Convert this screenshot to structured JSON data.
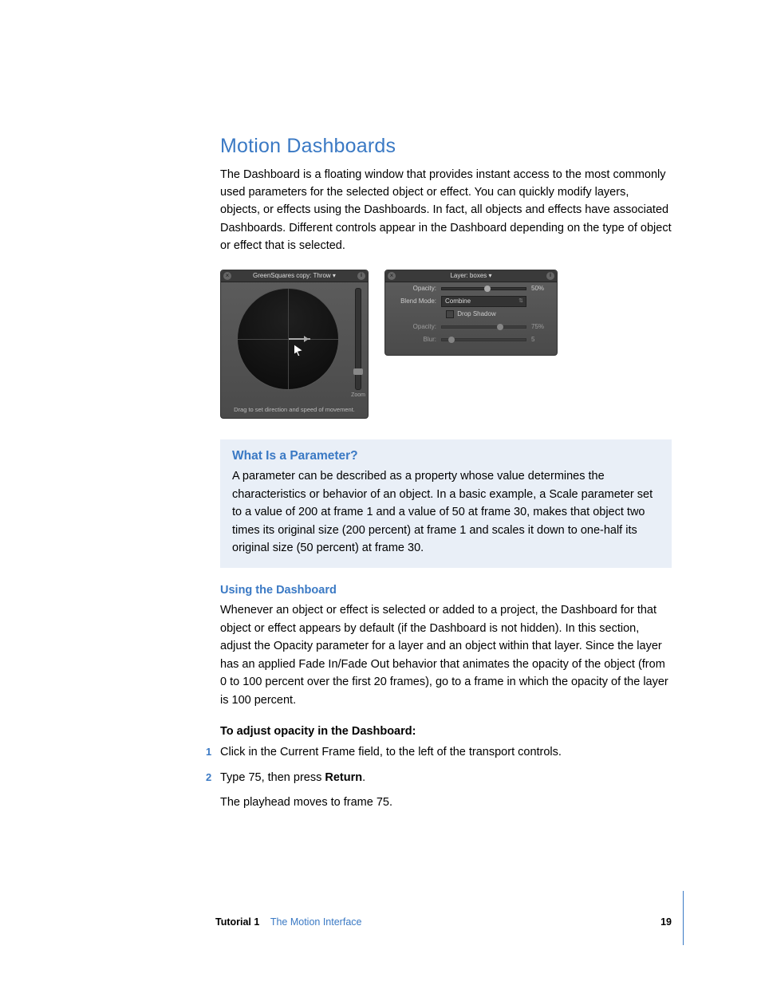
{
  "title": "Motion Dashboards",
  "intro": "The Dashboard is a floating window that provides instant access to the most commonly used parameters for the selected object or effect. You can quickly modify layers, objects, or effects using the Dashboards. In fact, all objects and effects have associated Dashboards. Different controls appear in the Dashboard depending on the type of object or effect that is selected.",
  "dash1": {
    "title": "GreenSquares copy: Throw ▾",
    "zoom_label": "Zoom",
    "hint": "Drag to set direction and speed\nof movement."
  },
  "dash2": {
    "title": "Layer: boxes ▾",
    "opacity_label": "Opacity:",
    "opacity_val": "50%",
    "opacity_knob_pct": 50,
    "blend_label": "Blend Mode:",
    "blend_val": "Combine",
    "drop_label": "Drop Shadow",
    "opacity2_label": "Opacity:",
    "opacity2_val": "75%",
    "opacity2_knob_pct": 66,
    "blur_label": "Blur:",
    "blur_val": "5",
    "blur_knob_pct": 8
  },
  "callout": {
    "heading": "What Is a Parameter?",
    "body": "A parameter can be described as a property whose value determines the characteristics or behavior of an object. In a basic example, a Scale parameter set to a value of 200 at frame 1 and a value of 50 at frame 30, makes that object two times its original size (200 percent) at frame 1 and scales it down to one-half its original size (50 percent) at frame 30."
  },
  "sub": {
    "heading": "Using the Dashboard",
    "body": "Whenever an object or effect is selected or added to a project, the Dashboard for that object or effect appears by default (if the Dashboard is not hidden). In this section, adjust the Opacity parameter for a layer and an object within that layer. Since the layer has an applied Fade In/Fade Out behavior that animates the opacity of the object (from 0 to 100 percent over the first 20 frames), go to a frame in which the opacity of the layer is 100 percent."
  },
  "todo_heading": "To adjust opacity in the Dashboard:",
  "steps": [
    "Click in the Current Frame field, to the left of the transport controls.",
    "Type 75, then press Return."
  ],
  "step_bold": "Return",
  "after_steps": "The playhead moves to frame 75.",
  "footer": {
    "tutorial": "Tutorial 1",
    "chapter": "The Motion Interface",
    "page": "19"
  }
}
